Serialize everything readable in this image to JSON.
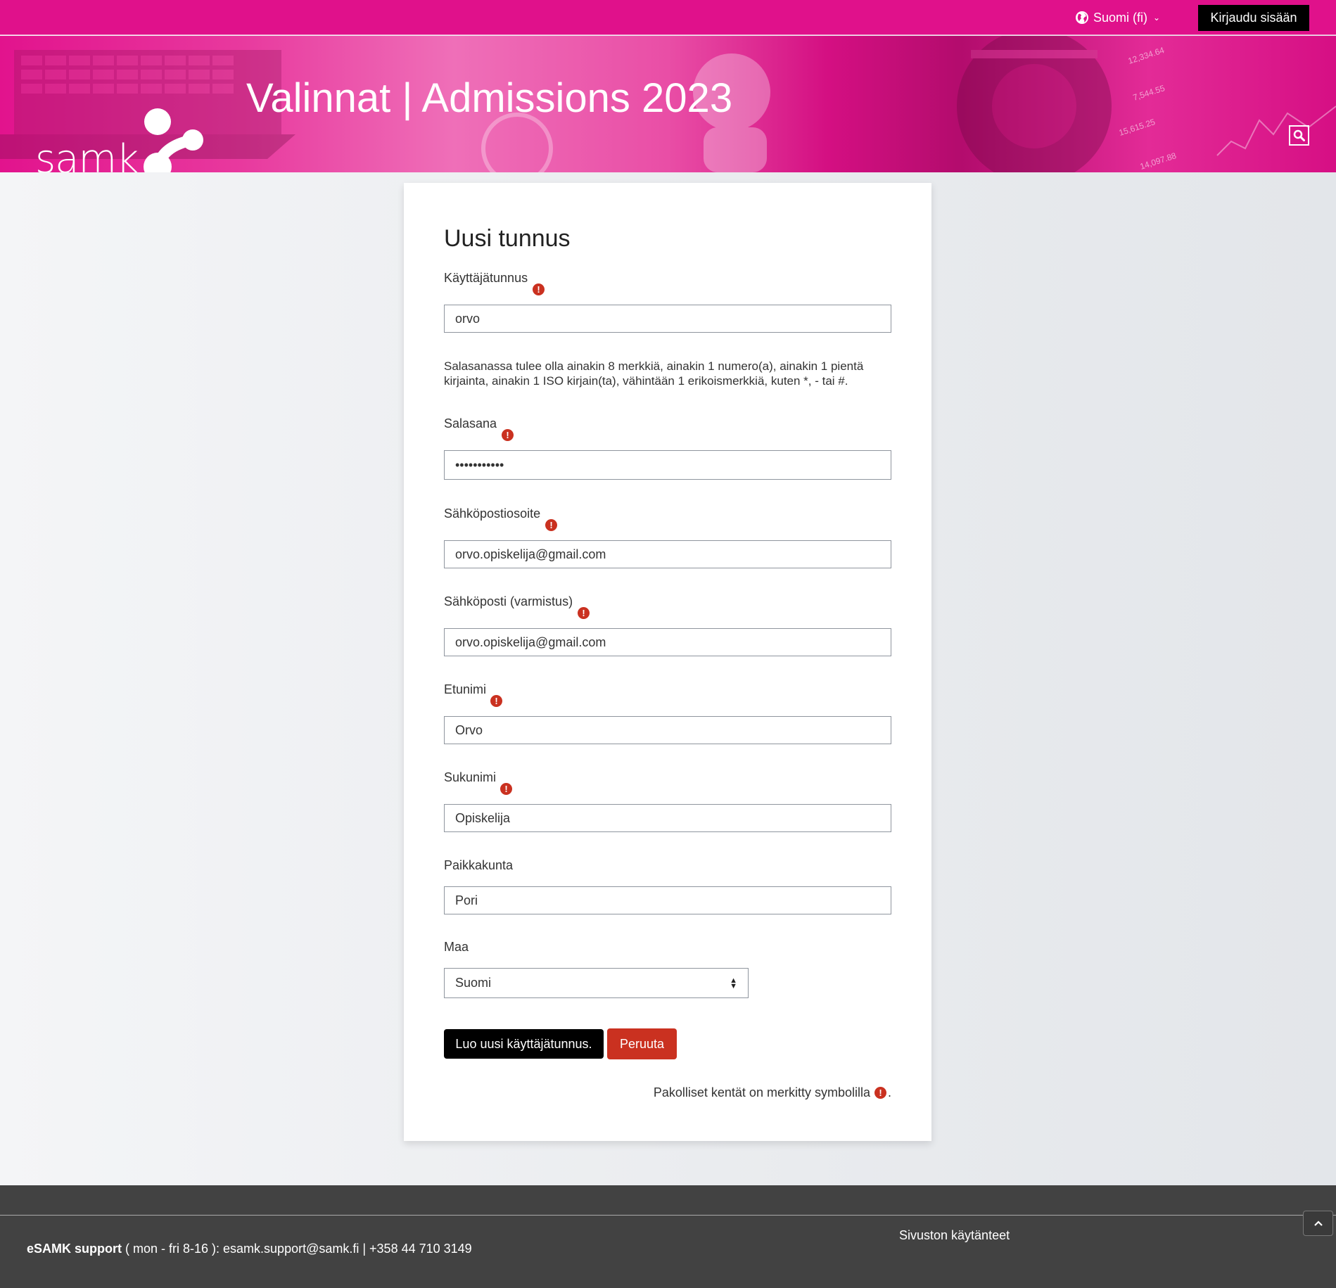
{
  "topbar": {
    "language": "Suomi (fi)",
    "login_button": "Kirjaudu sisään"
  },
  "banner": {
    "logo_text": "samk",
    "site_title": "Valinnat | Admissions 2023"
  },
  "form": {
    "title": "Uusi tunnus",
    "username": {
      "label": "Käyttäjätunnus",
      "value": "orvo"
    },
    "password_note": "Salasanassa tulee olla ainakin 8 merkkiä, ainakin 1 numero(a), ainakin 1 pientä kirjainta, ainakin 1 ISO kirjain(ta), vähintään 1 erikoismerkkiä, kuten *, - tai #.",
    "password": {
      "label": "Salasana",
      "value": "•••••••••••"
    },
    "email": {
      "label": "Sähköpostiosoite",
      "value": "orvo.opiskelija@gmail.com"
    },
    "email_confirm": {
      "label": "Sähköposti (varmistus)",
      "value": "orvo.opiskelija@gmail.com"
    },
    "firstname": {
      "label": "Etunimi",
      "value": "Orvo"
    },
    "lastname": {
      "label": "Sukunimi",
      "value": "Opiskelija"
    },
    "city": {
      "label": "Paikkakunta",
      "value": "Pori"
    },
    "country": {
      "label": "Maa",
      "value": "Suomi"
    },
    "submit_button": "Luo uusi käyttäjätunnus.",
    "cancel_button": "Peruuta",
    "required_note": "Pakolliset kentät on merkitty symbolilla",
    "required_note_end": ".",
    "required_symbol": "!"
  },
  "footer": {
    "support_title": "eSAMK support",
    "support_text": " ( mon - fri 8-16 ): esamk.support@samk.fi | +358 44 710 3149",
    "policies_link": "Sivuston käytänteet"
  },
  "colors": {
    "brand_magenta": "#e0118b",
    "required_red": "#ca3120",
    "footer_bg": "#424242"
  },
  "icons": {
    "language": "globe-icon",
    "search": "search-icon",
    "required": "exclamation-circle-icon",
    "back_to_top": "chevron-up-icon"
  }
}
